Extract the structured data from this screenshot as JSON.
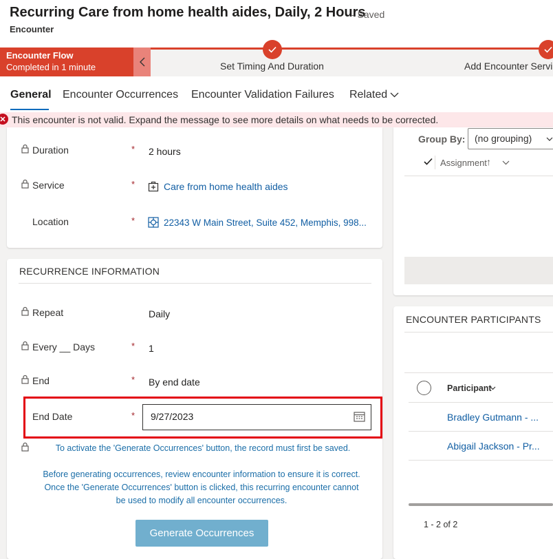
{
  "header": {
    "title": "Recurring Care from home health aides, Daily, 2 Hours",
    "saved": "- Saved",
    "entity": "Encounter"
  },
  "bpf": {
    "stage_name": "Encounter Flow",
    "stage_status": "Completed in 1 minute",
    "steps": [
      "Set Timing And Duration",
      "Add Encounter Servic"
    ]
  },
  "tabs": [
    "General",
    "Encounter Occurrences",
    "Encounter Validation Failures",
    "Related"
  ],
  "error_banner": "This encounter is not valid. Expand the message to see more details on what needs to be corrected.",
  "details": {
    "duration": {
      "label": "Duration",
      "value": "2 hours"
    },
    "service": {
      "label": "Service",
      "value": "Care from home health aides"
    },
    "location": {
      "label": "Location",
      "value": "22343 W Main Street, Suite 452, Memphis, 998..."
    }
  },
  "recurrence": {
    "title": "RECURRENCE INFORMATION",
    "repeat": {
      "label": "Repeat",
      "value": "Daily"
    },
    "every_days": {
      "label": "Every __ Days",
      "value": "1"
    },
    "end": {
      "label": "End",
      "value": "By end date"
    },
    "end_date": {
      "label": "End Date",
      "value": "9/27/2023"
    },
    "notice1": "To activate the 'Generate Occurrences' button, the record must first be saved.",
    "notice2_lines": [
      "Before generating occurrences, review encounter information to ensure it is correct.",
      "Once the 'Generate Occurrences' button is clicked, this recurring encounter cannot",
      "be used to modify all encounter occurrences."
    ],
    "generate_button": "Generate Occurrences"
  },
  "right": {
    "group_by_label": "Group By:",
    "group_by_value": "(no grouping)",
    "assignment_col": "Assignment",
    "participants_title": "ENCOUNTER PARTICIPANTS",
    "participant_col": "Participant",
    "participants": [
      "Bradley Gutmann - ...",
      "Abigail Jackson - Pr..."
    ],
    "pager": "1 - 2 of 2"
  },
  "colors": {
    "bpf_red": "#d9412b",
    "link_blue": "#115ea3",
    "error_red": "#c50f1f",
    "highlight": "#e3000f",
    "button_disabled": "#71afce"
  }
}
